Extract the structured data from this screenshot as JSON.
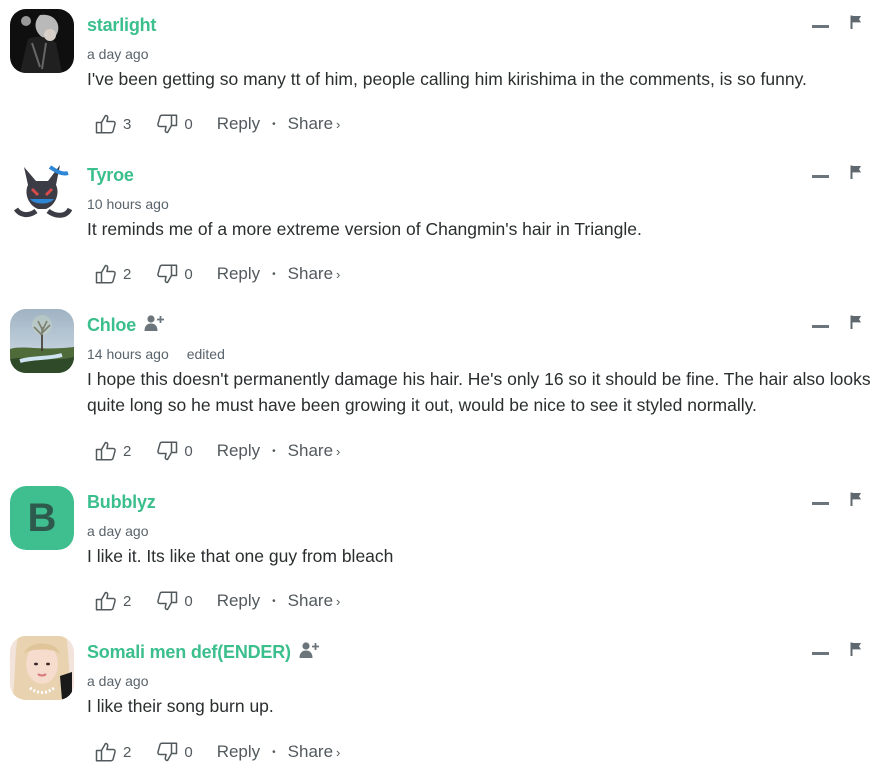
{
  "theme": {
    "username_color": "#3bbf8c",
    "muted_text": "#59636b",
    "body_text": "#2a2e2e",
    "action_text": "#525a5e"
  },
  "comments": [
    {
      "username": "starlight",
      "avatar": "photo-dark",
      "timestamp": "a day ago",
      "edited": "",
      "follow": false,
      "text": "I've been getting so many tt of him, people calling him kirishima in the comments, is so funny.",
      "upvotes": "3",
      "downvotes": "0",
      "reply_label": "Reply",
      "share_label": "Share"
    },
    {
      "username": "Tyroe",
      "avatar": "creature-illustration",
      "timestamp": "10 hours ago",
      "edited": "",
      "follow": false,
      "text": "It reminds me of a more extreme version of Changmin's hair in Triangle.",
      "upvotes": "2",
      "downvotes": "0",
      "reply_label": "Reply",
      "share_label": "Share"
    },
    {
      "username": "Chloe",
      "avatar": "landscape-tree",
      "timestamp": "14 hours ago",
      "edited": "edited",
      "follow": true,
      "text": "I hope this doesn't permanently damage his hair. He's only 16 so it should be fine. The hair also looks quite long so he must have been growing it out, would be nice to see it styled normally.",
      "upvotes": "2",
      "downvotes": "0",
      "reply_label": "Reply",
      "share_label": "Share"
    },
    {
      "username": "Bubblyz",
      "avatar": "letter",
      "avatar_letter": "B",
      "avatar_color": "#3fbf8f",
      "timestamp": "a day ago",
      "edited": "",
      "follow": false,
      "text": "I like it. Its like that one guy from bleach",
      "upvotes": "2",
      "downvotes": "0",
      "reply_label": "Reply",
      "share_label": "Share"
    },
    {
      "username": "Somali men def(ENDER)",
      "avatar": "photo-portrait",
      "timestamp": "a day ago",
      "edited": "",
      "follow": true,
      "text": "I like their song burn up.",
      "upvotes": "2",
      "downvotes": "0",
      "reply_label": "Reply",
      "share_label": "Share"
    }
  ],
  "icons": {
    "upvote": "thumbs-up-icon",
    "downvote": "thumbs-down-icon",
    "collapse": "minus-icon",
    "flag": "flag-icon",
    "follow": "follow-user-icon",
    "share_chevron": "›",
    "separator": "•"
  }
}
